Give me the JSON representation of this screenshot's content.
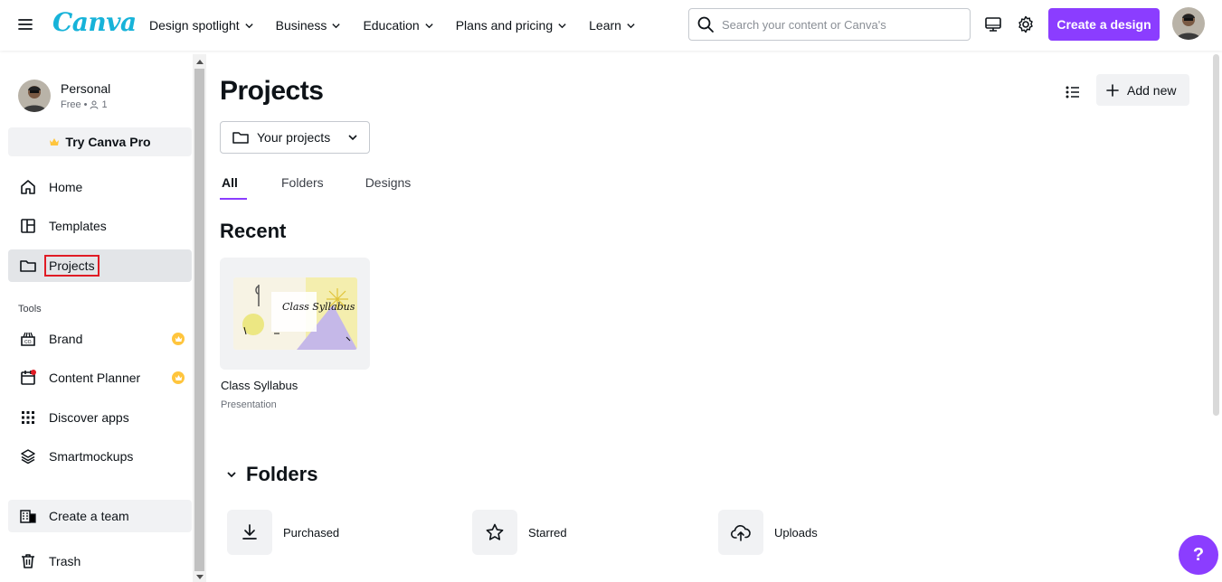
{
  "header": {
    "logo": "Canva",
    "nav": [
      {
        "label": "Design spotlight"
      },
      {
        "label": "Business"
      },
      {
        "label": "Education"
      },
      {
        "label": "Plans and pricing"
      },
      {
        "label": "Learn"
      }
    ],
    "search_placeholder": "Search your content or Canva's",
    "create_label": "Create a design",
    "accent_color": "#8b3dff"
  },
  "sidebar": {
    "profile_name": "Personal",
    "profile_plan": "Free",
    "profile_members": "1",
    "try_pro": "Try Canva Pro",
    "items": [
      {
        "label": "Home",
        "icon": "home-icon"
      },
      {
        "label": "Templates",
        "icon": "templates-icon"
      },
      {
        "label": "Projects",
        "icon": "folder-icon",
        "active": true
      }
    ],
    "tools_heading": "Tools",
    "tools": [
      {
        "label": "Brand",
        "icon": "brand-icon",
        "pro": true
      },
      {
        "label": "Content Planner",
        "icon": "calendar-icon",
        "pro": true
      },
      {
        "label": "Discover apps",
        "icon": "apps-grid-icon"
      },
      {
        "label": "Smartmockups",
        "icon": "layers-icon"
      }
    ],
    "create_team": "Create a team",
    "trash": "Trash"
  },
  "main": {
    "title": "Projects",
    "add_new": "Add new",
    "dropdown_value": "Your projects",
    "tabs": [
      {
        "label": "All",
        "active": true
      },
      {
        "label": "Folders"
      },
      {
        "label": "Designs"
      }
    ],
    "recent_heading": "Recent",
    "recent": [
      {
        "title": "Class Syllabus",
        "type": "Presentation",
        "thumb_text": "Class Syllabus"
      }
    ],
    "folders_heading": "Folders",
    "folders": [
      {
        "label": "Purchased",
        "icon": "download-icon"
      },
      {
        "label": "Starred",
        "icon": "star-icon"
      },
      {
        "label": "Uploads",
        "icon": "cloud-upload-icon"
      }
    ]
  },
  "help_label": "?"
}
